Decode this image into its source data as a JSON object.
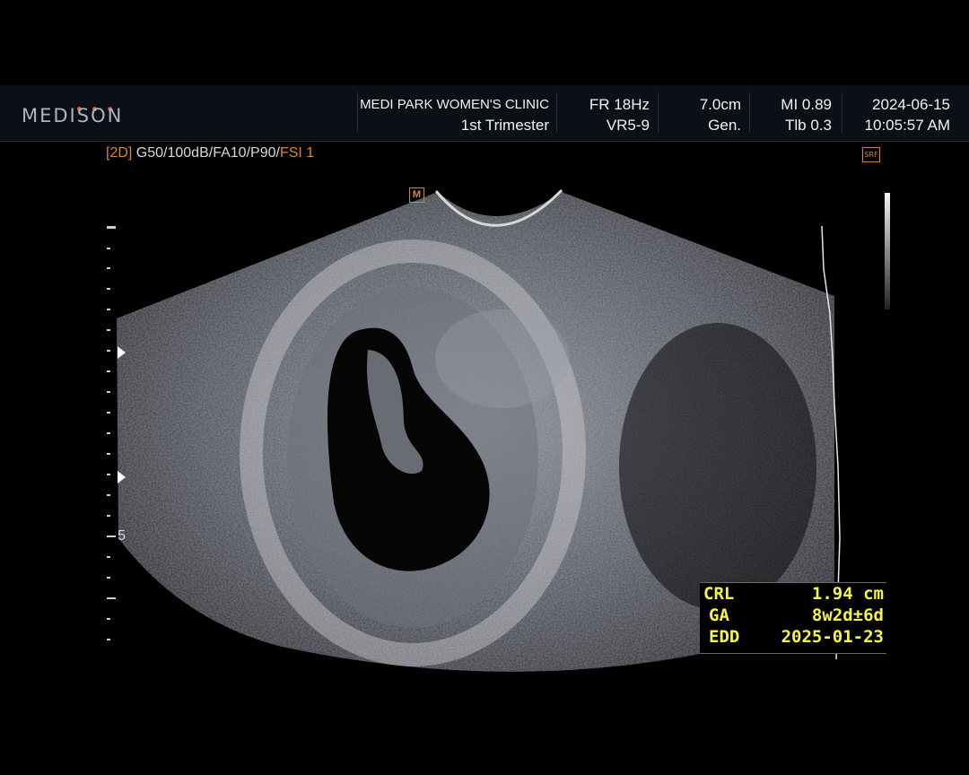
{
  "header": {
    "brand": "MEDISON",
    "brand_dot_colors": [
      "#e0622b",
      "#e0622b",
      "#e03a2b"
    ],
    "clinic": "MEDI PARK WOMEN'S CLINIC",
    "preset": "1st Trimester",
    "frame_rate": "FR 18Hz",
    "volume_preset": "VR5-9",
    "depth": "7.0cm",
    "mode": "Gen.",
    "mi": "MI 0.89",
    "tib": "Tlb 0.3",
    "date": "2024-06-15",
    "time": "10:05:57 AM"
  },
  "imaging_params": {
    "mode": "[2D]",
    "g": "G50/",
    "dr": "100dB/",
    "fa": "FA10/",
    "p": "P90/",
    "fsi": "FSI 1"
  },
  "indicators": {
    "srf_label": "SRF",
    "orientation_marker": "M",
    "depth_scale_label": "5"
  },
  "measurements": [
    {
      "label": "CRL",
      "value": "1.94 cm"
    },
    {
      "label": "GA",
      "value": "8w2d±6d"
    },
    {
      "label": "EDD",
      "value": "2025-01-23"
    }
  ],
  "colors": {
    "accent_orange": "#d7882c",
    "measurement_yellow": "#f5f542"
  }
}
